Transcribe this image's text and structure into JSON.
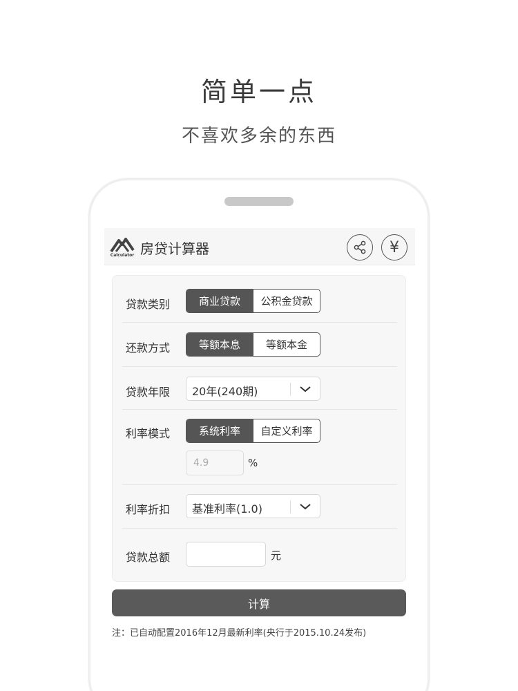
{
  "promo": {
    "headline": "简单一点",
    "subline": "不喜欢多余的东西"
  },
  "app": {
    "title": "房贷计算器",
    "logo_text": "Calculator",
    "share_icon": "share-icon",
    "yen_symbol": "¥"
  },
  "form": {
    "loan_type": {
      "label": "贷款类别",
      "options": [
        "商业贷款",
        "公积金贷款"
      ],
      "selected": "商业贷款"
    },
    "repayment": {
      "label": "还款方式",
      "options": [
        "等额本息",
        "等额本金"
      ],
      "selected": "等额本息"
    },
    "term": {
      "label": "贷款年限",
      "value": "20年(240期)"
    },
    "rate_mode": {
      "label": "利率模式",
      "options": [
        "系统利率",
        "自定义利率"
      ],
      "selected": "系统利率",
      "rate_value": "4.9",
      "rate_unit": "%"
    },
    "discount": {
      "label": "利率折扣",
      "value": "基准利率(1.0)"
    },
    "amount": {
      "label": "贷款总额",
      "value": "",
      "unit": "元"
    }
  },
  "calculate_label": "计算",
  "note": "注：已自动配置2016年12月最新利率(央行于2015.10.24发布)",
  "colors": {
    "active_segment": "#555555",
    "calc_button": "#5a5a5a",
    "card_bg": "#f7f7f7"
  }
}
